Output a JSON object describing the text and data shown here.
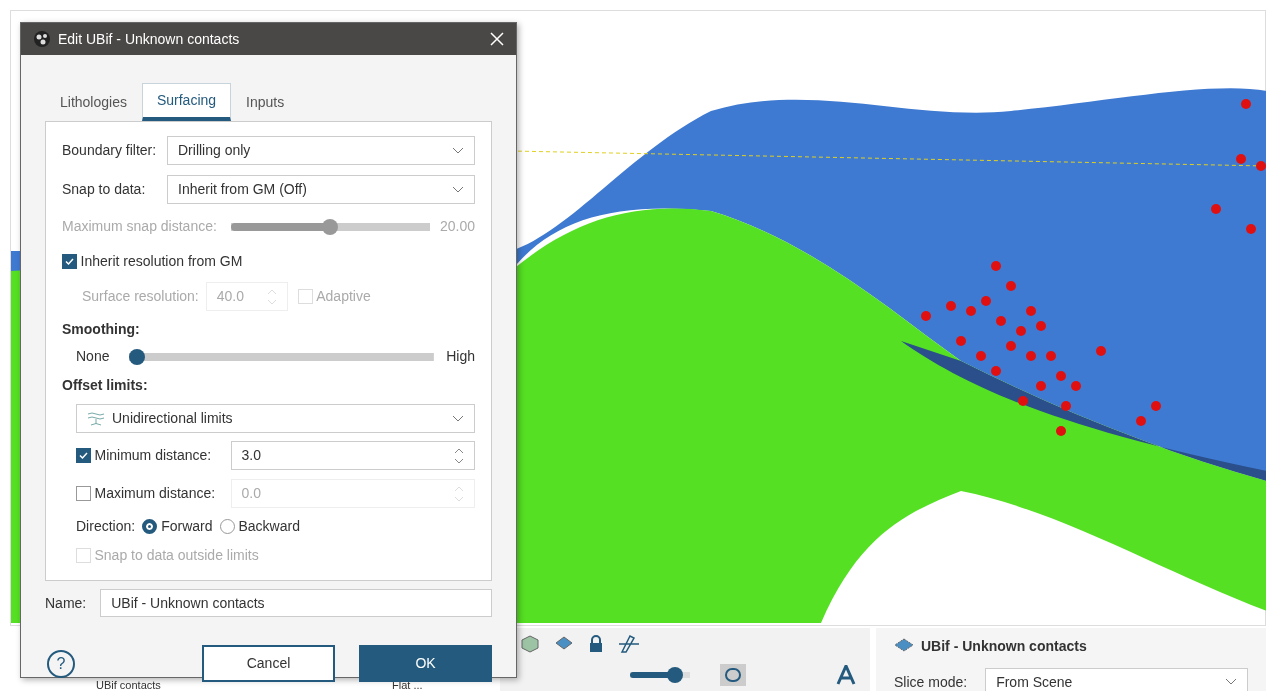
{
  "dialog": {
    "title": "Edit UBif - Unknown contacts",
    "tabs": [
      {
        "label": "Lithologies",
        "selected": false
      },
      {
        "label": "Surfacing",
        "selected": true
      },
      {
        "label": "Inputs",
        "selected": false
      }
    ],
    "boundary_filter": {
      "label": "Boundary filter:",
      "value": "Drilling only"
    },
    "snap_to_data": {
      "label": "Snap to data:",
      "value": "Inherit from GM (Off)"
    },
    "max_snap_distance": {
      "label": "Maximum snap distance:",
      "level": 0.5,
      "reading": "20.00",
      "disabled": true
    },
    "inherit_resolution": {
      "label": "Inherit resolution from GM",
      "checked": true
    },
    "surface_resolution": {
      "label": "Surface resolution:",
      "value": "40.0",
      "disabled": true
    },
    "adaptive": {
      "label": "Adaptive",
      "checked": false,
      "disabled": true
    },
    "smoothing": {
      "heading": "Smoothing:",
      "min_label": "None",
      "max_label": "High",
      "level": 0
    },
    "offset_limits": {
      "heading": "Offset limits:",
      "mode": "Unidirectional limits"
    },
    "minimum_distance": {
      "label": "Minimum distance:",
      "checked": true,
      "value": "3.0"
    },
    "maximum_distance": {
      "label": "Maximum distance:",
      "checked": false,
      "value": "0.0"
    },
    "direction": {
      "label": "Direction:",
      "options": [
        {
          "label": "Forward",
          "selected": true
        },
        {
          "label": "Backward",
          "selected": false
        }
      ]
    },
    "snap_outside": {
      "label": "Snap to data outside limits",
      "checked": false,
      "disabled": true
    },
    "name": {
      "label": "Name:",
      "value": "UBif - Unknown contacts"
    },
    "help": "?",
    "buttons": [
      {
        "label": "Cancel",
        "kind": "secondary"
      },
      {
        "label": "OK",
        "kind": "primary"
      }
    ]
  },
  "opacity_slider": {
    "level": 0.85
  },
  "bottom_list": {
    "item": "UBif contacts",
    "style": "Flat ..."
  },
  "properties_panel": {
    "title": "UBif - Unknown contacts",
    "slice_mode": {
      "label": "Slice mode:",
      "value": "From Scene"
    }
  }
}
